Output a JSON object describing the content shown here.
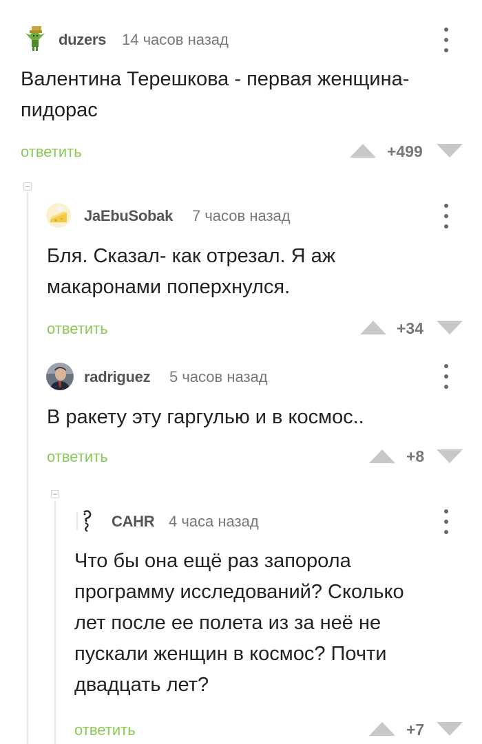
{
  "comments": [
    {
      "username": "duzers",
      "time": "14 часов назад",
      "text": "Валентина Терешкова - первая женщина-\nпидорас",
      "reply_label": "ответить",
      "rating": "+499",
      "avatar_icon": "green-goblin-avatar-icon"
    },
    {
      "username": "JaEbuSobak",
      "time": "7 часов назад",
      "text": "Бля. Сказал- как отрезал. Я аж\nмакаронами поперхнулся.",
      "reply_label": "ответить",
      "rating": "+34",
      "avatar_icon": "cheese-avatar-icon"
    },
    {
      "username": "radriguez",
      "time": "5 часов назад",
      "text": "В ракету эту гаргулью и в космос..",
      "reply_label": "ответить",
      "rating": "+8",
      "avatar_icon": "photo-avatar-icon"
    },
    {
      "username": "CAHR",
      "time": "4 часа назад",
      "text": "Что бы она ещё раз запорола\nпрограмму исследований? Сколько\nлет после ее полета из за неё не\nпускали женщин в космос? Почти\nдвадцать лет?",
      "reply_label": "ответить",
      "rating": "+7",
      "avatar_icon": "sketch-avatar-icon"
    }
  ],
  "colors": {
    "reply": "#8ac858",
    "vote_arrow": "#c8c8c8",
    "thread_line": "#e6e6e6"
  }
}
